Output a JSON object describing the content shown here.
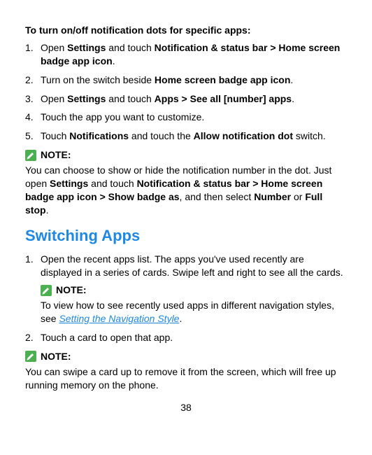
{
  "heading1": "To turn on/off notification dots for specific apps:",
  "list1": {
    "n1": "1.",
    "i1a": "Open ",
    "i1b": "Settings",
    "i1c": " and touch ",
    "i1d": "Notification & status bar > Home screen badge app icon",
    "i1e": ".",
    "n2": "2.",
    "i2a": "Turn on the switch beside ",
    "i2b": "Home screen badge app icon",
    "i2c": ".",
    "n3": "3.",
    "i3a": "Open ",
    "i3b": "Settings",
    "i3c": " and touch ",
    "i3d": "Apps > See all [number] apps",
    "i3e": ".",
    "n4": "4.",
    "i4": "Touch the app you want to customize.",
    "n5": "5.",
    "i5a": "Touch ",
    "i5b": "Notifications",
    "i5c": " and touch the ",
    "i5d": "Allow notification dot",
    "i5e": " switch."
  },
  "noteLabel": "NOTE:",
  "note1": {
    "a": "You can choose to show or hide the notification number in the dot. Just open ",
    "b": "Settings",
    "c": " and touch ",
    "d": "Notification & status bar > Home screen badge app icon > Show badge as",
    "e": ", and then select ",
    "f": "Number",
    "g": " or ",
    "h": "Full stop",
    "i": "."
  },
  "sectionTitle": "Switching Apps",
  "list2": {
    "n1": "1.",
    "i1": "Open the recent apps list. The apps you've used recently are displayed in a series of cards. Swipe left and right to see all the cards.",
    "note2a": "To view how to see recently used apps in different navigation styles, see ",
    "note2link": "Setting the Navigation Style",
    "note2b": ".",
    "n2": "2.",
    "i2": "Touch a card to open that app."
  },
  "note3": "You can swipe a card up to remove it from the screen, which will free up running memory on the phone.",
  "pageNum": "38"
}
